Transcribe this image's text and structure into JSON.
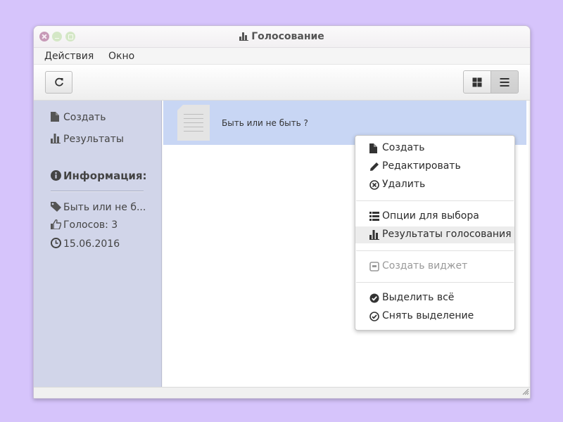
{
  "window": {
    "title": "Голосование"
  },
  "menubar": {
    "items": [
      {
        "label": "Действия"
      },
      {
        "label": "Окно"
      }
    ]
  },
  "toolbar": {
    "refresh_icon": "refresh-icon",
    "grid_icon": "grid-view-icon",
    "list_icon": "list-view-icon",
    "active_view": "list"
  },
  "sidebar": {
    "actions": [
      {
        "label": "Создать",
        "icon": "file-icon"
      },
      {
        "label": "Результаты",
        "icon": "bar-chart-icon"
      }
    ],
    "info": {
      "title": "Информация:",
      "question": "Быть или не б...",
      "votes": "Голосов: 3",
      "date": "15.06.2016"
    }
  },
  "content": {
    "items": [
      {
        "title": "Быть или не быть ?",
        "icon": "document-icon"
      }
    ]
  },
  "context_menu": {
    "groups": [
      [
        {
          "label": "Создать",
          "icon": "file-icon"
        },
        {
          "label": "Редактировать",
          "icon": "pencil-icon"
        },
        {
          "label": "Удалить",
          "icon": "circle-x-icon"
        }
      ],
      [
        {
          "label": "Опции для выбора",
          "icon": "list-icon"
        },
        {
          "label": "Результаты голосования",
          "icon": "bar-chart-icon",
          "highlighted": true
        }
      ],
      [
        {
          "label": "Создать виджет",
          "icon": "widget-icon",
          "disabled": true
        }
      ],
      [
        {
          "label": "Выделить всё",
          "icon": "check-circle-filled-icon"
        },
        {
          "label": "Снять выделение",
          "icon": "check-circle-outline-icon"
        }
      ]
    ]
  },
  "colors": {
    "desktop": "#d6c4fb",
    "sidebar": "#d1d5e9",
    "selection": "#c8d6f4",
    "highlight": "#ececec"
  }
}
